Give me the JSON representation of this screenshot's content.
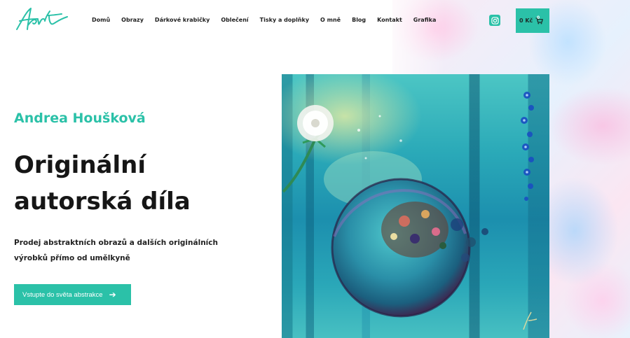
{
  "site": {
    "logo_text": "Hart"
  },
  "nav": {
    "items": [
      {
        "label": "Domů"
      },
      {
        "label": "Obrazy"
      },
      {
        "label": "Dárkové krabičky"
      },
      {
        "label": "Oblečení"
      },
      {
        "label": "Tisky a doplňky"
      },
      {
        "label": "O mně"
      },
      {
        "label": "Blog"
      },
      {
        "label": "Kontakt"
      },
      {
        "label": "Grafika"
      }
    ]
  },
  "header_actions": {
    "instagram_icon": "instagram-icon",
    "cart_price": "0 Kč",
    "cart_count": "0",
    "cart_icon": "cart-icon"
  },
  "hero": {
    "name": "Andrea Houšková",
    "title": "Originální autorská díla",
    "subtitle": "Prodej abstraktních obrazů a dalších originálních výrobků přímo od umělkyně",
    "cta_label": "Vstupte do světa abstrakce",
    "cta_icon": "arrow-right-icon"
  },
  "colors": {
    "accent": "#2bc1a8",
    "heading": "#161616",
    "text": "#222222"
  }
}
